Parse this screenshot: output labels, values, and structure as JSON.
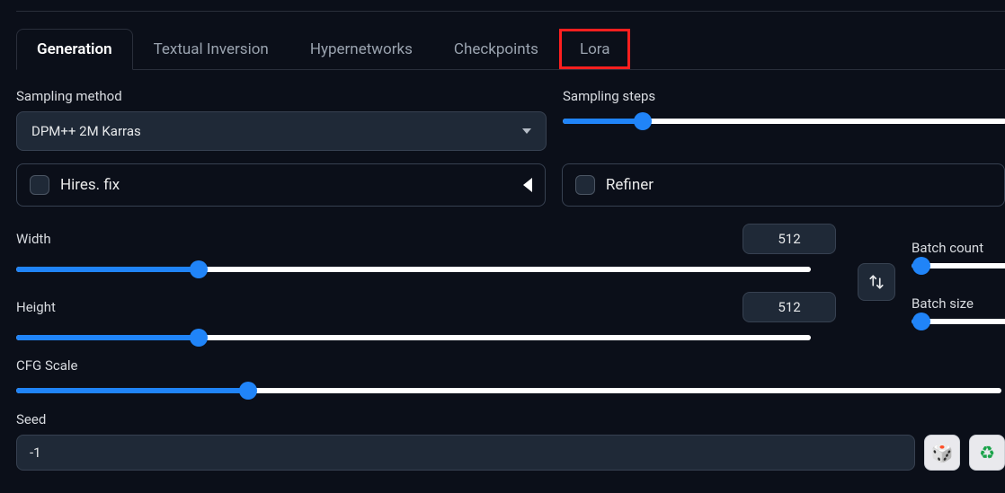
{
  "tabs": {
    "generation": "Generation",
    "textual_inversion": "Textual Inversion",
    "hypernetworks": "Hypernetworks",
    "checkpoints": "Checkpoints",
    "lora": "Lora"
  },
  "labels": {
    "sampling_method": "Sampling method",
    "sampling_steps": "Sampling steps",
    "hires_fix": "Hires. fix",
    "refiner": "Refiner",
    "width": "Width",
    "height": "Height",
    "batch_count": "Batch count",
    "batch_size": "Batch size",
    "cfg_scale": "CFG Scale",
    "seed": "Seed"
  },
  "values": {
    "sampling_method": "DPM++ 2M Karras",
    "sampling_steps_pct": 18,
    "width": "512",
    "height": "512",
    "width_pct": 23,
    "height_pct": 23,
    "cfg_pct": 23.5,
    "batch_count_pct": 10,
    "batch_size_pct": 10,
    "seed": "-1"
  },
  "icons": {
    "dice": "🎲",
    "recycle": "♻"
  }
}
